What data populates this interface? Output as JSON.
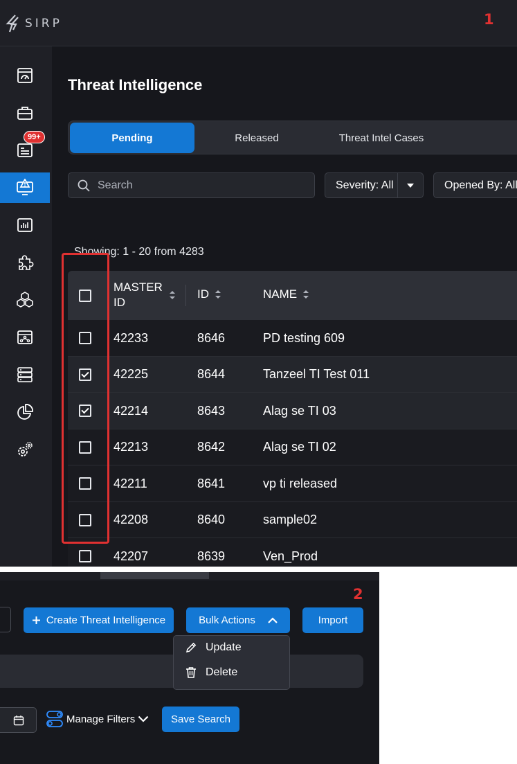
{
  "app": {
    "brand": "SIRP"
  },
  "steps": {
    "one": "1",
    "two": "2"
  },
  "sidebar": {
    "items": [
      {
        "icon": "dashboard-icon"
      },
      {
        "icon": "briefcase-icon"
      },
      {
        "icon": "incidents-icon",
        "badge": "99+"
      },
      {
        "icon": "threat-intel-icon",
        "active": true
      },
      {
        "icon": "reports-icon"
      },
      {
        "icon": "puzzle-icon"
      },
      {
        "icon": "cubes-icon"
      },
      {
        "icon": "workflow-icon"
      },
      {
        "icon": "database-icon"
      },
      {
        "icon": "pie-chart-icon"
      },
      {
        "icon": "settings-icon"
      }
    ]
  },
  "page": {
    "title": "Threat Intelligence"
  },
  "tabs": [
    {
      "label": "Pending",
      "active": true
    },
    {
      "label": "Released"
    },
    {
      "label": "Threat Intel Cases"
    }
  ],
  "search": {
    "placeholder": "Search"
  },
  "filters": {
    "severity": "Severity: All",
    "opened_by": "Opened By: All"
  },
  "showing": "Showing: 1 - 20 from 4283",
  "table": {
    "columns": {
      "master_id": "MASTER ID",
      "id": "ID",
      "name": "NAME"
    },
    "rows": [
      {
        "master_id": "42233",
        "id": "8646",
        "name": "PD testing 609",
        "checked": false
      },
      {
        "master_id": "42225",
        "id": "8644",
        "name": "Tanzeel TI Test 011",
        "checked": true
      },
      {
        "master_id": "42214",
        "id": "8643",
        "name": "Alag se TI 03",
        "checked": true
      },
      {
        "master_id": "42213",
        "id": "8642",
        "name": "Alag se TI 02",
        "checked": false
      },
      {
        "master_id": "42211",
        "id": "8641",
        "name": "vp ti released",
        "checked": false
      },
      {
        "master_id": "42208",
        "id": "8640",
        "name": "sample02",
        "checked": false
      },
      {
        "master_id": "42207",
        "id": "8639",
        "name": "Ven_Prod",
        "checked": false
      }
    ]
  },
  "toolbar": {
    "create_label": "Create Threat Intelligence",
    "bulk_label": "Bulk Actions",
    "import_label": "Import",
    "manage_filters_label": "Manage Filters",
    "save_search_label": "Save Search"
  },
  "bulk_menu": {
    "update_label": "Update",
    "delete_label": "Delete"
  },
  "colors": {
    "accent": "#1478d4",
    "highlight": "#e03131",
    "background": "#16171c"
  }
}
